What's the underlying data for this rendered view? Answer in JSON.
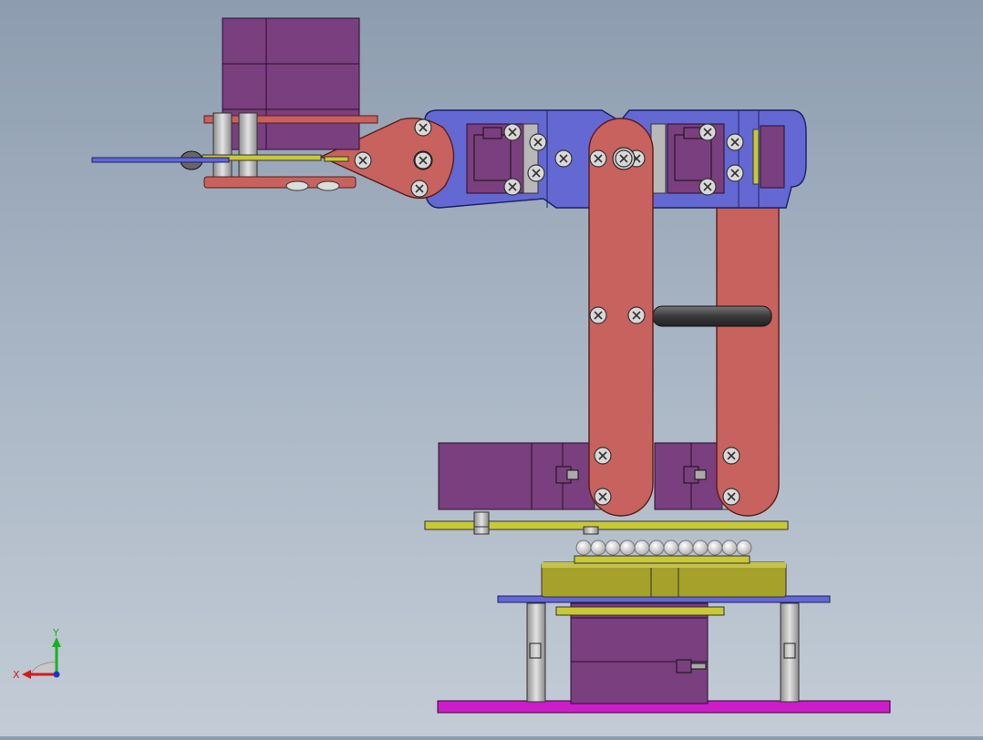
{
  "viewport": {
    "background_top": "#8d9caf",
    "background_bottom": "#c3ccd6"
  },
  "colors": {
    "servo": "#7a3f7e",
    "servo_dark": "#5d2b62",
    "bracket_blue": "#6468d3",
    "link_red": "#c7625e",
    "plate_yellow": "#c9c836",
    "base_gold": "#a6a12a",
    "base_magenta": "#cc1dc8",
    "standoff": "#b9b9b9",
    "rod": "#4d4d4d"
  },
  "triad": {
    "x_label": "X",
    "y_label": "Y",
    "x_color": "#d11b1b",
    "y_color": "#17b21f",
    "z_color": "#2233c9"
  }
}
